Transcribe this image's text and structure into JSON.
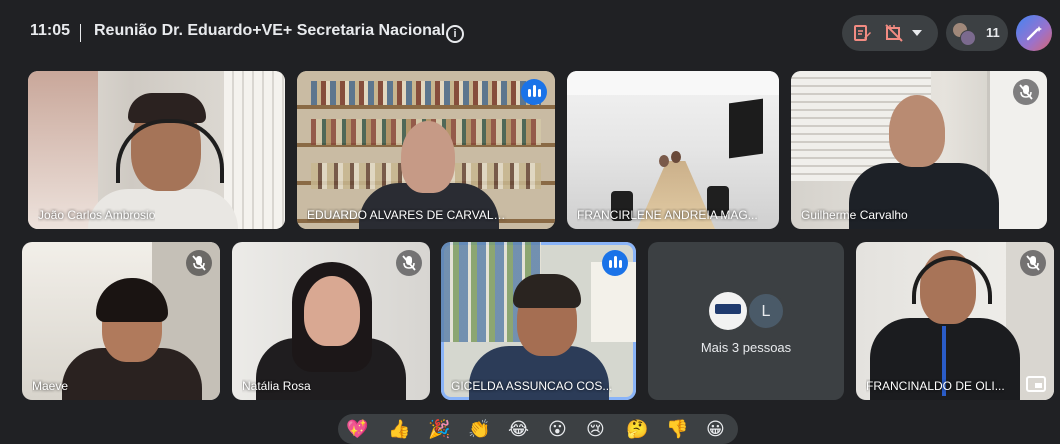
{
  "header": {
    "time": "11:05",
    "meeting_title": "Reunião Dr. Eduardo+VE+ Secretaria Nacional",
    "participant_count": "11"
  },
  "tiles": [
    {
      "name": "João Carlos Ambrosio",
      "muted": false
    },
    {
      "name": "EDUARDO ALVARES DE CARVALHO",
      "speaking": true
    },
    {
      "name": "FRANCIRLENE ANDREIA MAG...",
      "muted": false
    },
    {
      "name": "Guilherme Carvalho",
      "muted": true
    },
    {
      "name": "Maeve",
      "muted": true
    },
    {
      "name": "Natália Rosa",
      "muted": true
    },
    {
      "name": "GICELDA ASSUNCAO COS...",
      "speaking": true
    },
    {
      "name": "FRANCINALDO DE OLI...",
      "muted": true
    }
  ],
  "more_tile": {
    "avatar_letter": "L",
    "label": "Mais 3 pessoas"
  },
  "colors": {
    "background": "#202124",
    "tile": "#3c4043",
    "accent_blue": "#8ab4f8",
    "speaking": "#1a73e8"
  },
  "reactions": [
    "💖",
    "👍",
    "🎉",
    "👏",
    "😂",
    "😮",
    "😢",
    "🤔",
    "👎",
    "😀"
  ]
}
